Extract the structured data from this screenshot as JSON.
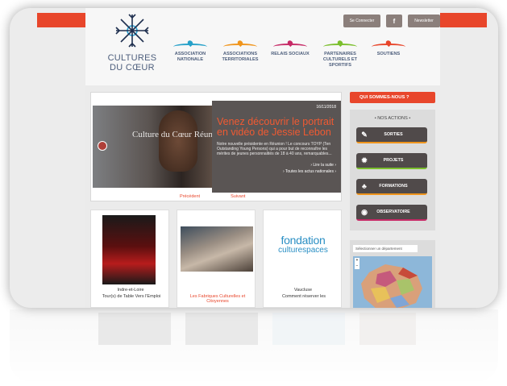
{
  "brand": {
    "line1": "CULTURES",
    "line2": "DU CŒUR"
  },
  "top_actions": [
    {
      "label": "Se Connecter"
    },
    {
      "label": "f"
    },
    {
      "label": "Newsletter"
    }
  ],
  "nav": [
    {
      "label": "ASSOCIATION NATIONALE",
      "color": "#27a1c9"
    },
    {
      "label": "ASSOCIATIONS TERRITORIALES",
      "color": "#f0951c"
    },
    {
      "label": "RELAIS SOCIAUX",
      "color": "#c62a66"
    },
    {
      "label": "PARTENAIRES CULTURELS ET SPORTIFS",
      "color": "#7bbf2d"
    },
    {
      "label": "SOUTIENS",
      "color": "#e8462b"
    }
  ],
  "hero": {
    "date": "16/11/2018",
    "title": "Venez découvrir le portrait en vidéo de Jessie Lebon",
    "body": "Notre nouvelle présidente en Réunion ! Le concours TOYP (Ten Outstanding Young Persons) qui a pour but de reconnaître les mérites de jeunes personnalités de 18 à 40 ans, remarquables...",
    "read_more": "› Lire la suite ›",
    "all_news": "› Toutes les actus nationales ›",
    "video_overlay": "Culture du Cœur Réunion",
    "prev": "Précédent",
    "next": "Suivant"
  },
  "tiles": [
    {
      "cap1": "Indre-et-Loire",
      "cap2": "Tour(s) de Table Vers l'Emploi",
      "cap2_color": "#333333"
    },
    {
      "cap1": "",
      "cap2": "Les Fabriques Culturelles et Citoyennes",
      "cap2_color": "#e8462b"
    },
    {
      "cap1": "Vaucluse",
      "cap2": "Comment réserver les",
      "cap2_color": "#333333",
      "logo_top": "fondation",
      "logo_bottom": "culturespaces"
    }
  ],
  "sidebar": {
    "who": "QUI SOMMES-NOUS ?",
    "actions_title": "• NOS ACTIONS •",
    "actions": [
      {
        "label": "SORTIES",
        "icon": "ticket-icon",
        "glyph": "✎"
      },
      {
        "label": "PROJETS",
        "icon": "lightbulb-icon",
        "glyph": "✹"
      },
      {
        "label": "FORMATIONS",
        "icon": "people-icon",
        "glyph": "♣"
      },
      {
        "label": "OBSERVATOIRE",
        "icon": "target-icon",
        "glyph": "◉"
      }
    ],
    "map_select": "Sélectionner un département"
  },
  "colors": {
    "accent": "#e8462b",
    "dark": "#504a4a",
    "nav_text": "#4d5e7c"
  }
}
